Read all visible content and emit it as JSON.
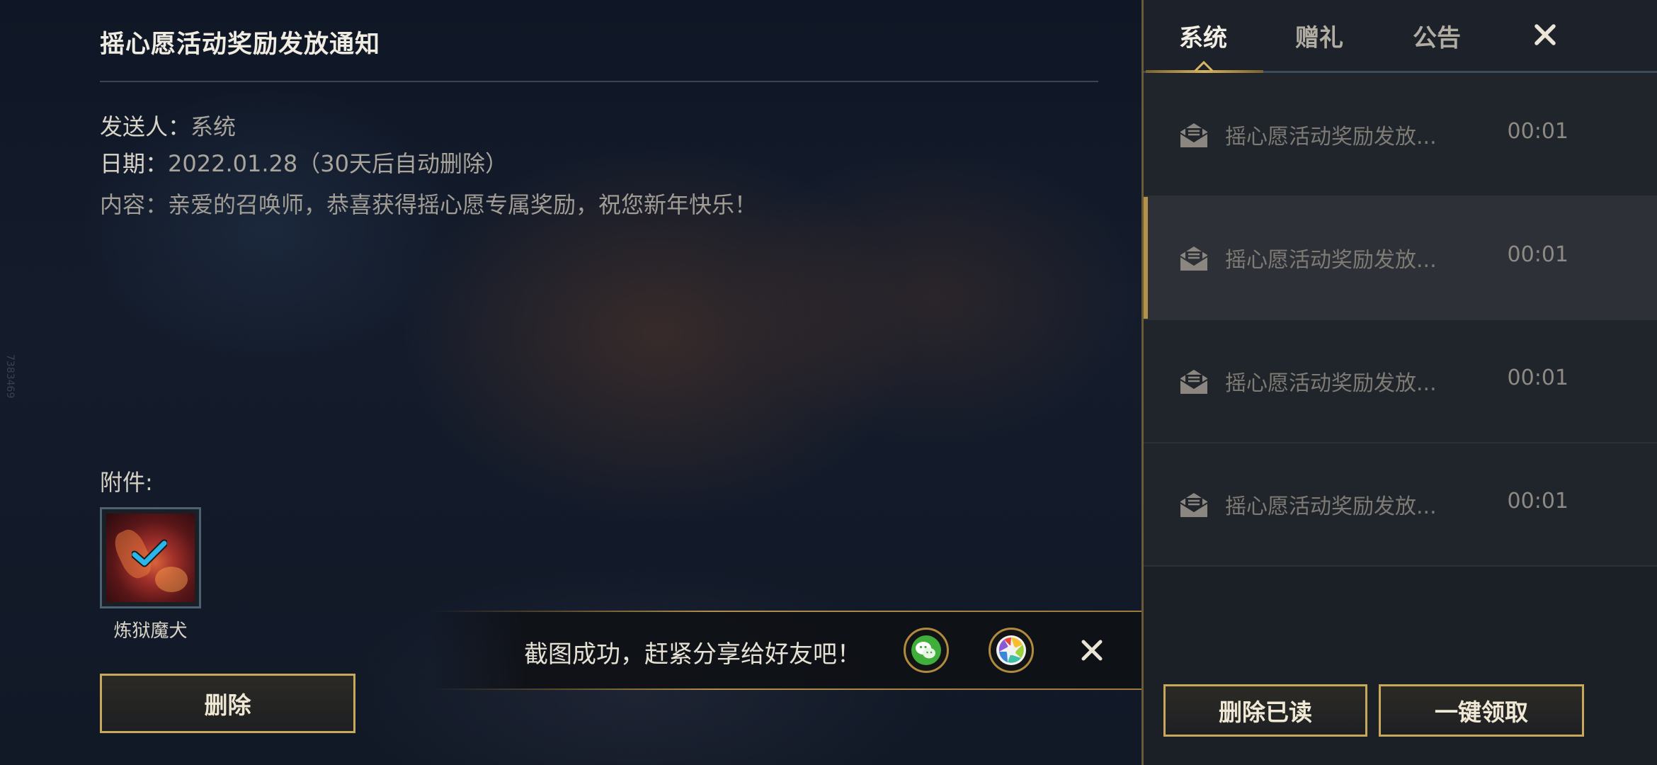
{
  "detail": {
    "title": "摇心愿活动奖励发放通知",
    "sender_label": "发送人：",
    "sender_value": "系统",
    "date_label": "日期：",
    "date_value": "2022.01.28（30天后自动删除）",
    "content_label": "内容：",
    "content_value": "亲爱的召唤师，恭喜获得摇心愿专属奖励，祝您新年快乐！",
    "attachment_label": "附件:",
    "attachment_name": "炼狱魔犬",
    "delete_label": "删除"
  },
  "toast": {
    "message": "截图成功，赶紧分享给好友吧！"
  },
  "sidebar": {
    "tabs": [
      {
        "label": "系统",
        "active": true
      },
      {
        "label": "赠礼",
        "active": false
      },
      {
        "label": "公告",
        "active": false
      }
    ],
    "mails": [
      {
        "subject": "摇心愿活动奖励发放...",
        "time": "00:01",
        "selected": false
      },
      {
        "subject": "摇心愿活动奖励发放...",
        "time": "00:01",
        "selected": true
      },
      {
        "subject": "摇心愿活动奖励发放...",
        "time": "00:01",
        "selected": false
      },
      {
        "subject": "摇心愿活动奖励发放...",
        "time": "00:01",
        "selected": false
      }
    ],
    "delete_read_label": "删除已读",
    "claim_all_label": "一键领取"
  },
  "watermark": "7383469",
  "colors": {
    "accent_gold": "#c8a95c",
    "panel_bg": "#1b1f26",
    "check_blue": "#2ab6e8"
  }
}
